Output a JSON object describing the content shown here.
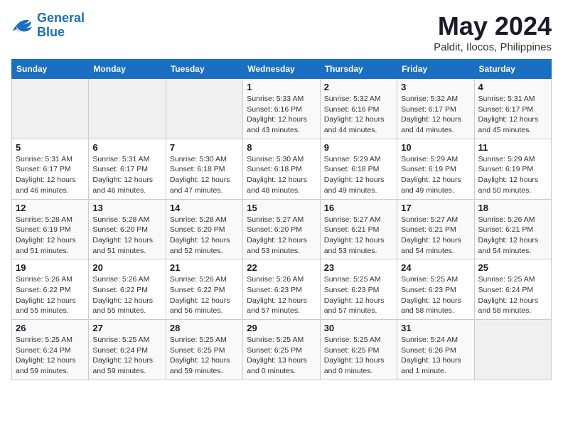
{
  "header": {
    "logo_line1": "General",
    "logo_line2": "Blue",
    "month": "May 2024",
    "location": "Paldit, Ilocos, Philippines"
  },
  "weekdays": [
    "Sunday",
    "Monday",
    "Tuesday",
    "Wednesday",
    "Thursday",
    "Friday",
    "Saturday"
  ],
  "weeks": [
    [
      {
        "day": "",
        "info": ""
      },
      {
        "day": "",
        "info": ""
      },
      {
        "day": "",
        "info": ""
      },
      {
        "day": "1",
        "info": "Sunrise: 5:33 AM\nSunset: 6:16 PM\nDaylight: 12 hours\nand 43 minutes."
      },
      {
        "day": "2",
        "info": "Sunrise: 5:32 AM\nSunset: 6:16 PM\nDaylight: 12 hours\nand 44 minutes."
      },
      {
        "day": "3",
        "info": "Sunrise: 5:32 AM\nSunset: 6:17 PM\nDaylight: 12 hours\nand 44 minutes."
      },
      {
        "day": "4",
        "info": "Sunrise: 5:31 AM\nSunset: 6:17 PM\nDaylight: 12 hours\nand 45 minutes."
      }
    ],
    [
      {
        "day": "5",
        "info": "Sunrise: 5:31 AM\nSunset: 6:17 PM\nDaylight: 12 hours\nand 46 minutes."
      },
      {
        "day": "6",
        "info": "Sunrise: 5:31 AM\nSunset: 6:17 PM\nDaylight: 12 hours\nand 46 minutes."
      },
      {
        "day": "7",
        "info": "Sunrise: 5:30 AM\nSunset: 6:18 PM\nDaylight: 12 hours\nand 47 minutes."
      },
      {
        "day": "8",
        "info": "Sunrise: 5:30 AM\nSunset: 6:18 PM\nDaylight: 12 hours\nand 48 minutes."
      },
      {
        "day": "9",
        "info": "Sunrise: 5:29 AM\nSunset: 6:18 PM\nDaylight: 12 hours\nand 49 minutes."
      },
      {
        "day": "10",
        "info": "Sunrise: 5:29 AM\nSunset: 6:19 PM\nDaylight: 12 hours\nand 49 minutes."
      },
      {
        "day": "11",
        "info": "Sunrise: 5:29 AM\nSunset: 6:19 PM\nDaylight: 12 hours\nand 50 minutes."
      }
    ],
    [
      {
        "day": "12",
        "info": "Sunrise: 5:28 AM\nSunset: 6:19 PM\nDaylight: 12 hours\nand 51 minutes."
      },
      {
        "day": "13",
        "info": "Sunrise: 5:28 AM\nSunset: 6:20 PM\nDaylight: 12 hours\nand 51 minutes."
      },
      {
        "day": "14",
        "info": "Sunrise: 5:28 AM\nSunset: 6:20 PM\nDaylight: 12 hours\nand 52 minutes."
      },
      {
        "day": "15",
        "info": "Sunrise: 5:27 AM\nSunset: 6:20 PM\nDaylight: 12 hours\nand 53 minutes."
      },
      {
        "day": "16",
        "info": "Sunrise: 5:27 AM\nSunset: 6:21 PM\nDaylight: 12 hours\nand 53 minutes."
      },
      {
        "day": "17",
        "info": "Sunrise: 5:27 AM\nSunset: 6:21 PM\nDaylight: 12 hours\nand 54 minutes."
      },
      {
        "day": "18",
        "info": "Sunrise: 5:26 AM\nSunset: 6:21 PM\nDaylight: 12 hours\nand 54 minutes."
      }
    ],
    [
      {
        "day": "19",
        "info": "Sunrise: 5:26 AM\nSunset: 6:22 PM\nDaylight: 12 hours\nand 55 minutes."
      },
      {
        "day": "20",
        "info": "Sunrise: 5:26 AM\nSunset: 6:22 PM\nDaylight: 12 hours\nand 55 minutes."
      },
      {
        "day": "21",
        "info": "Sunrise: 5:26 AM\nSunset: 6:22 PM\nDaylight: 12 hours\nand 56 minutes."
      },
      {
        "day": "22",
        "info": "Sunrise: 5:26 AM\nSunset: 6:23 PM\nDaylight: 12 hours\nand 57 minutes."
      },
      {
        "day": "23",
        "info": "Sunrise: 5:25 AM\nSunset: 6:23 PM\nDaylight: 12 hours\nand 57 minutes."
      },
      {
        "day": "24",
        "info": "Sunrise: 5:25 AM\nSunset: 6:23 PM\nDaylight: 12 hours\nand 58 minutes."
      },
      {
        "day": "25",
        "info": "Sunrise: 5:25 AM\nSunset: 6:24 PM\nDaylight: 12 hours\nand 58 minutes."
      }
    ],
    [
      {
        "day": "26",
        "info": "Sunrise: 5:25 AM\nSunset: 6:24 PM\nDaylight: 12 hours\nand 59 minutes."
      },
      {
        "day": "27",
        "info": "Sunrise: 5:25 AM\nSunset: 6:24 PM\nDaylight: 12 hours\nand 59 minutes."
      },
      {
        "day": "28",
        "info": "Sunrise: 5:25 AM\nSunset: 6:25 PM\nDaylight: 12 hours\nand 59 minutes."
      },
      {
        "day": "29",
        "info": "Sunrise: 5:25 AM\nSunset: 6:25 PM\nDaylight: 13 hours\nand 0 minutes."
      },
      {
        "day": "30",
        "info": "Sunrise: 5:25 AM\nSunset: 6:25 PM\nDaylight: 13 hours\nand 0 minutes."
      },
      {
        "day": "31",
        "info": "Sunrise: 5:24 AM\nSunset: 6:26 PM\nDaylight: 13 hours\nand 1 minute."
      },
      {
        "day": "",
        "info": ""
      }
    ]
  ]
}
